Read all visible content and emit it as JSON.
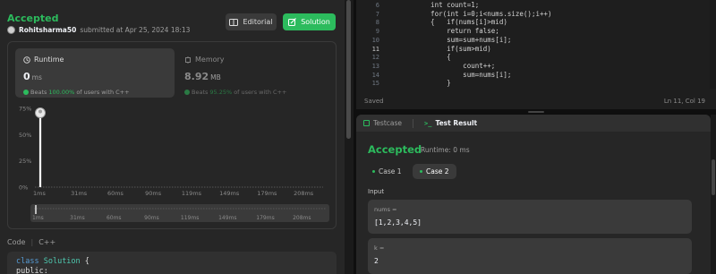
{
  "submission": {
    "status": "Accepted",
    "username": "Rohitsharma50",
    "submitted_text": "submitted at Apr 25, 2024 18:13",
    "editorial_label": "Editorial",
    "solution_label": "Solution"
  },
  "runtime": {
    "title": "Runtime",
    "value": "0",
    "unit": "ms",
    "beats_prefix": "Beats",
    "beats_pct": "100.00%",
    "beats_suffix": "of users with C++"
  },
  "memory": {
    "title": "Memory",
    "value": "8.92",
    "unit": "MB",
    "beats_prefix": "Beats",
    "beats_pct": "95.25%",
    "beats_suffix": "of users with C++"
  },
  "chart_data": {
    "type": "bar",
    "yticks": [
      "75%",
      "50%",
      "25%",
      "0%"
    ],
    "ylim": [
      0,
      75
    ],
    "x_labels": [
      "1ms",
      "31ms",
      "60ms",
      "90ms",
      "119ms",
      "149ms",
      "179ms",
      "208ms"
    ],
    "mini_x_labels": [
      "1ms",
      "31ms",
      "60ms",
      "90ms",
      "119ms",
      "149ms",
      "179ms",
      "208ms"
    ],
    "categories_ms": [
      1,
      31,
      60,
      90,
      119,
      149,
      179,
      208
    ],
    "highlight": {
      "x": 1,
      "y": 69
    },
    "values": [
      69
    ]
  },
  "code": {
    "header_label": "Code",
    "language": "C++",
    "line1_kw": "class",
    "line1_name": "Solution",
    "line1_rest": " {",
    "line2": "public:"
  },
  "editor": {
    "line_numbers": [
      "6",
      "7",
      "8",
      "9",
      "10",
      "11",
      "12",
      "13",
      "14",
      "15"
    ],
    "active_line": "11",
    "lines": [
      "    int count=1;",
      "    for(int i=0;i<nums.size();i++)",
      "    {   if(nums[i]>mid)",
      "        return false;",
      "        sum=sum+nums[i];",
      "        if(sum>mid)",
      "        {",
      "            count++;",
      "            sum=nums[i];",
      "        }"
    ],
    "status_saved": "Saved",
    "status_pos": "Ln 11, Col 19"
  },
  "result": {
    "tab_testcase": "Testcase",
    "tab_testresult": "Test Result",
    "status": "Accepted",
    "runtime": "Runtime: 0 ms",
    "case1": "Case 1",
    "case2": "Case 2",
    "input_label": "Input",
    "nums_name": "nums =",
    "nums_value": "[1,2,3,4,5]",
    "k_name": "k =",
    "k_value": "2"
  },
  "colors": {
    "accent_green": "#2cbb5d",
    "panel_bg": "#262626",
    "editor_bg": "#1e1e1e"
  }
}
